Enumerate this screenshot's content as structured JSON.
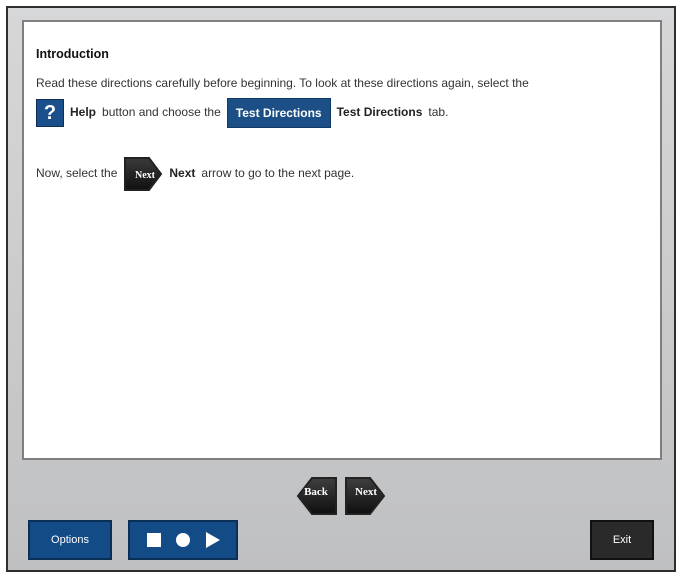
{
  "content": {
    "title": "Introduction",
    "line1": "Read these directions carefully before beginning. To look at these directions again, select the",
    "line2": {
      "help_glyph": "?",
      "help_label": "Help",
      "middle_text": "button and choose the",
      "tab_button_label": "Test Directions",
      "tab_text_label": "Test Directions",
      "end_text": "tab."
    },
    "line3": {
      "start_text": "Now, select the",
      "next_icon_text": "Next",
      "next_label": "Next",
      "end_text": "arrow to go to the next page."
    }
  },
  "nav": {
    "back_label": "Back",
    "next_label": "Next"
  },
  "bottom": {
    "options_label": "Options",
    "media": {
      "stop_icon": "stop-icon",
      "record_icon": "record-icon",
      "play_icon": "play-icon"
    },
    "exit_label": "Exit"
  },
  "colors": {
    "button_blue": "#124b86",
    "dark_button": "#2a2a2a",
    "panel_border": "#2f2f2f",
    "content_border": "#7f7f7f"
  }
}
